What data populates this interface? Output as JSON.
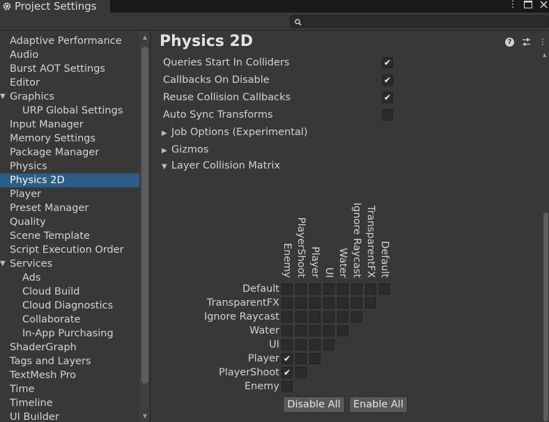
{
  "window": {
    "title": "Project Settings",
    "controls": [
      "more-icon",
      "maximize-icon",
      "close-icon"
    ]
  },
  "search": {
    "placeholder": ""
  },
  "sidebar": {
    "items": [
      {
        "label": "Adaptive Performance",
        "indent": 0,
        "expandable": false,
        "selected": false
      },
      {
        "label": "Audio",
        "indent": 0,
        "expandable": false,
        "selected": false
      },
      {
        "label": "Burst AOT Settings",
        "indent": 0,
        "expandable": false,
        "selected": false
      },
      {
        "label": "Editor",
        "indent": 0,
        "expandable": false,
        "selected": false
      },
      {
        "label": "Graphics",
        "indent": 0,
        "expandable": true,
        "selected": false
      },
      {
        "label": "URP Global Settings",
        "indent": 1,
        "expandable": false,
        "selected": false
      },
      {
        "label": "Input Manager",
        "indent": 0,
        "expandable": false,
        "selected": false
      },
      {
        "label": "Memory Settings",
        "indent": 0,
        "expandable": false,
        "selected": false
      },
      {
        "label": "Package Manager",
        "indent": 0,
        "expandable": false,
        "selected": false
      },
      {
        "label": "Physics",
        "indent": 0,
        "expandable": false,
        "selected": false
      },
      {
        "label": "Physics 2D",
        "indent": 0,
        "expandable": false,
        "selected": true
      },
      {
        "label": "Player",
        "indent": 0,
        "expandable": false,
        "selected": false
      },
      {
        "label": "Preset Manager",
        "indent": 0,
        "expandable": false,
        "selected": false
      },
      {
        "label": "Quality",
        "indent": 0,
        "expandable": false,
        "selected": false
      },
      {
        "label": "Scene Template",
        "indent": 0,
        "expandable": false,
        "selected": false
      },
      {
        "label": "Script Execution Order",
        "indent": 0,
        "expandable": false,
        "selected": false
      },
      {
        "label": "Services",
        "indent": 0,
        "expandable": true,
        "selected": false
      },
      {
        "label": "Ads",
        "indent": 1,
        "expandable": false,
        "selected": false
      },
      {
        "label": "Cloud Build",
        "indent": 1,
        "expandable": false,
        "selected": false
      },
      {
        "label": "Cloud Diagnostics",
        "indent": 1,
        "expandable": false,
        "selected": false
      },
      {
        "label": "Collaborate",
        "indent": 1,
        "expandable": false,
        "selected": false
      },
      {
        "label": "In-App Purchasing",
        "indent": 1,
        "expandable": false,
        "selected": false
      },
      {
        "label": "ShaderGraph",
        "indent": 0,
        "expandable": false,
        "selected": false
      },
      {
        "label": "Tags and Layers",
        "indent": 0,
        "expandable": false,
        "selected": false
      },
      {
        "label": "TextMesh Pro",
        "indent": 0,
        "expandable": false,
        "selected": false
      },
      {
        "label": "Time",
        "indent": 0,
        "expandable": false,
        "selected": false
      },
      {
        "label": "Timeline",
        "indent": 0,
        "expandable": false,
        "selected": false
      },
      {
        "label": "UI Builder",
        "indent": 0,
        "expandable": false,
        "selected": false
      }
    ]
  },
  "content": {
    "title": "Physics 2D",
    "header_icons": [
      "help-icon",
      "preset-icon",
      "more-icon"
    ],
    "properties": [
      {
        "label": "Queries Start In Colliders",
        "checked": true
      },
      {
        "label": "Callbacks On Disable",
        "checked": true
      },
      {
        "label": "Reuse Collision Callbacks",
        "checked": true
      },
      {
        "label": "Auto Sync Transforms",
        "checked": false
      }
    ],
    "foldouts": [
      {
        "label": "Job Options (Experimental)",
        "expanded": false
      },
      {
        "label": "Gizmos",
        "expanded": false
      },
      {
        "label": "Layer Collision Matrix",
        "expanded": true
      }
    ],
    "matrix": {
      "layers": [
        "Default",
        "TransparentFX",
        "Ignore Raycast",
        "Water",
        "UI",
        "Player",
        "PlayerShoot",
        "Enemy"
      ],
      "column_layers": [
        "Enemy",
        "PlayerShoot",
        "Player",
        "UI",
        "Water",
        "Ignore Raycast",
        "TransparentFX",
        "Default"
      ],
      "checked": [
        [
          false,
          false,
          false,
          false,
          false,
          false,
          false,
          false
        ],
        [
          false,
          false,
          false,
          false,
          false,
          false,
          false
        ],
        [
          false,
          false,
          false,
          false,
          false,
          false
        ],
        [
          false,
          false,
          false,
          false,
          false
        ],
        [
          false,
          false,
          false,
          false
        ],
        [
          true,
          false,
          false
        ],
        [
          true,
          false
        ],
        [
          false
        ]
      ]
    },
    "buttons": {
      "disable_all": "Disable All",
      "enable_all": "Enable All"
    }
  }
}
